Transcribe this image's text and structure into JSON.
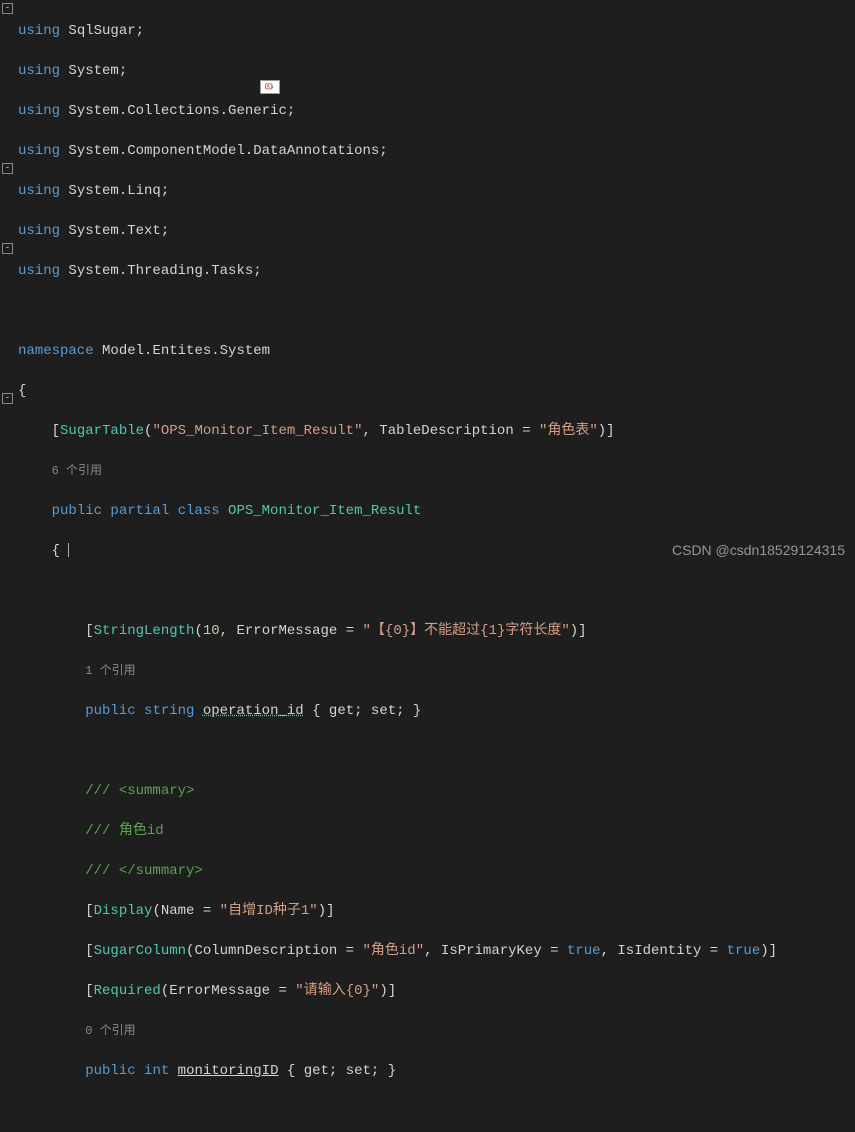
{
  "usings": [
    "SqlSugar",
    "System",
    "System.Collections.Generic",
    "System.ComponentModel.DataAnnotations",
    "System.Linq",
    "System.Text",
    "System.Threading.Tasks"
  ],
  "namespace": "Model.Entites.System",
  "class": {
    "attr_table": "SugarTable",
    "attr_table_name": "\"OPS_Monitor_Item_Result\"",
    "attr_table_desc_key": "TableDescription",
    "attr_table_desc_val": "\"角色表\"",
    "refs1": "6 个引用",
    "modifiers": "public partial class",
    "name": "OPS_Monitor_Item_Result"
  },
  "prop1": {
    "attr": "StringLength",
    "attr_num": "10",
    "attr_err_key": "ErrorMessage",
    "attr_err_val": "\"【{0}】不能超过{1}字符长度\"",
    "refs": "1 个引用",
    "mods": "public string",
    "name": "operation_id",
    "accessors": "{ get; set; }"
  },
  "doc": {
    "l1": "/// <summary>",
    "l2": "/// 角色id",
    "l3": "/// </summary>"
  },
  "prop2": {
    "disp_attr": "Display",
    "disp_key": "Name",
    "disp_val": "\"自增ID种子1\"",
    "col_attr": "SugarColumn",
    "col_desc_key": "ColumnDescription",
    "col_desc_val": "\"角色id\"",
    "col_pk_key": "IsPrimaryKey",
    "col_pk_val": "true",
    "col_ident_key": "IsIdentity",
    "col_ident_val": "true",
    "req_attr": "Required",
    "req_key": "ErrorMessage",
    "req_val": "\"请输入{0}\"",
    "refs": "0 个引用",
    "mods": "public int",
    "name": "monitoringID",
    "accessors": "{ get; set; }"
  },
  "watermark": "CSDN @csdn18529124315"
}
